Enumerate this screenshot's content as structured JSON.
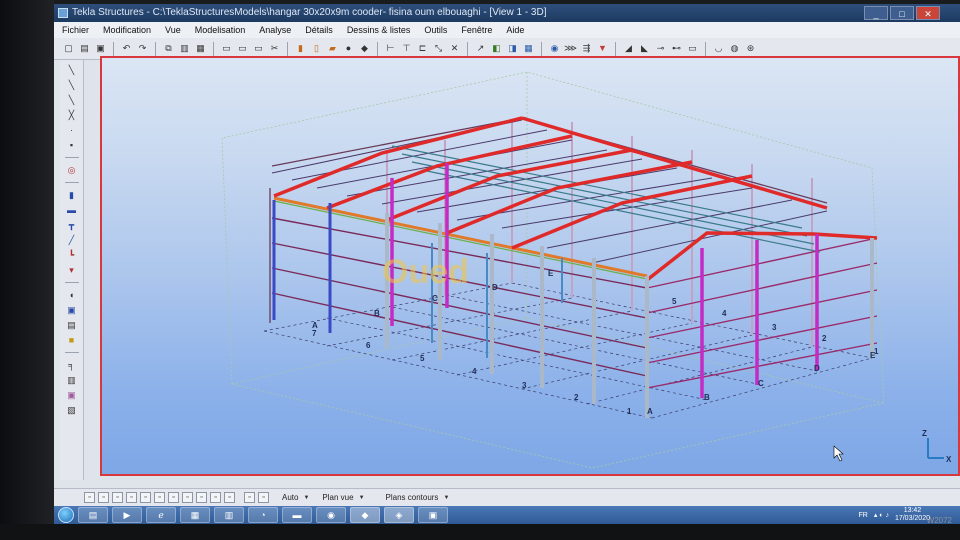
{
  "window": {
    "title": "Tekla Structures - C:\\TeklaStructuresModels\\hangar 30x20x9m cooder- fisina oum elbouaghi - [View 1 - 3D]",
    "controls": [
      "_",
      "□",
      "✕"
    ]
  },
  "menu": [
    "Fichier",
    "Modification",
    "Vue",
    "Modelisation",
    "Analyse",
    "Détails",
    "Dessins & listes",
    "Outils",
    "Fenêtre",
    "Aide"
  ],
  "toolbar_icons": [
    "new-icon",
    "open-icon",
    "save-icon",
    "undo-icon",
    "redo-icon",
    "copy-icon",
    "paste-icon",
    "print-icon",
    "cut-icon",
    "view-icon",
    "view-icon",
    "view-icon",
    "grid-icon",
    "beam-icon",
    "column-icon",
    "plate-icon",
    "bolt-icon",
    "weld-icon",
    "measure-icon",
    "snap-icon",
    "snap-icon",
    "snap-icon",
    "snap-icon",
    "component-icon",
    "drawing-icon",
    "drawing-icon",
    "report-icon",
    "settings-icon",
    "help-icon"
  ],
  "left_toolbar_icons": [
    "line-icon",
    "line-icon",
    "line-icon",
    "line-icon",
    "point-icon",
    "point-icon",
    "circle-icon",
    "beam-icon",
    "beam-icon",
    "beam-icon",
    "beam-icon",
    "beam-icon",
    "component-icon",
    "component-icon",
    "component-icon",
    "component-icon",
    "component-icon",
    "component-icon",
    "component-icon"
  ],
  "viewport": {
    "watermark": "Oued",
    "grid_labels_numbers": [
      "1",
      "2",
      "3",
      "4",
      "5",
      "6",
      "7"
    ],
    "grid_labels_letters_front": [
      "A",
      "B",
      "C",
      "D",
      "E"
    ],
    "grid_labels_letters_back": [
      "A",
      "B",
      "C",
      "D",
      "E"
    ],
    "grid_labels_right": [
      "1",
      "2",
      "3",
      "4",
      "5"
    ],
    "axis_labels": [
      "Z",
      "X"
    ]
  },
  "statusbar": {
    "select_mode": "Auto",
    "select_plane": "Plan vue",
    "select_contour": "Plans contours"
  },
  "taskbar": {
    "apps": [
      "explorer",
      "media",
      "ie",
      "files",
      "office",
      "network",
      "chrome",
      "tekla",
      "tekla-alt",
      "excel"
    ]
  },
  "tray": {
    "lang": "FR",
    "time": "13:42",
    "date": "17/03/2020"
  },
  "monitor": {
    "label": "W2072"
  }
}
